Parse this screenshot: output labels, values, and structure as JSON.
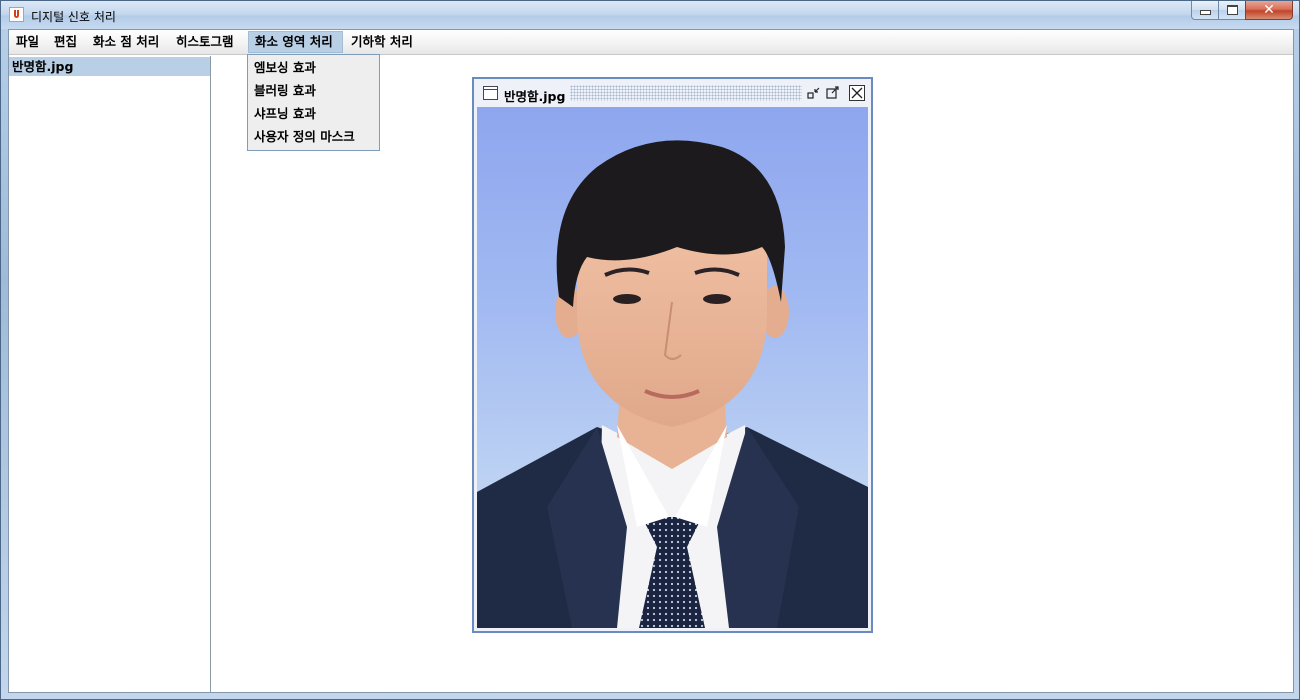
{
  "window": {
    "title": "디지털 신호 처리"
  },
  "menu_bar": {
    "items": [
      {
        "label": "파일"
      },
      {
        "label": "편집"
      },
      {
        "label": "화소 점 처리"
      },
      {
        "label": "히스토그램"
      },
      {
        "label": "화소 영역 처리"
      },
      {
        "label": "기하학 처리"
      }
    ],
    "open_menu": "화소 영역 처리"
  },
  "dropdown": {
    "items": [
      {
        "label": "엠보싱 효과"
      },
      {
        "label": "블러링 효과"
      },
      {
        "label": "샤프닝 효과"
      },
      {
        "label": "사용자 정의 마스크"
      }
    ]
  },
  "file_list": {
    "items": [
      {
        "label": "반명함.jpg",
        "selected": true
      }
    ]
  },
  "internal_frame": {
    "title": "반명함.jpg",
    "image_alt": "ID photo of a young man in a dark suit, white shirt and navy dotted tie on a blue gradient background"
  },
  "colors": {
    "selection": "#b8cfe5",
    "frame_border": "#6a8bbf",
    "photo_background_top": "#8ea6ee",
    "photo_background_bottom": "#c9dbf4",
    "suit": "#1f2a44",
    "tie": "#1b2440"
  },
  "icons": {
    "app": "java-cup-icon",
    "frame": "window-icon",
    "iconify": "iconify-icon",
    "maximize": "maximize-icon",
    "close": "close-icon"
  }
}
